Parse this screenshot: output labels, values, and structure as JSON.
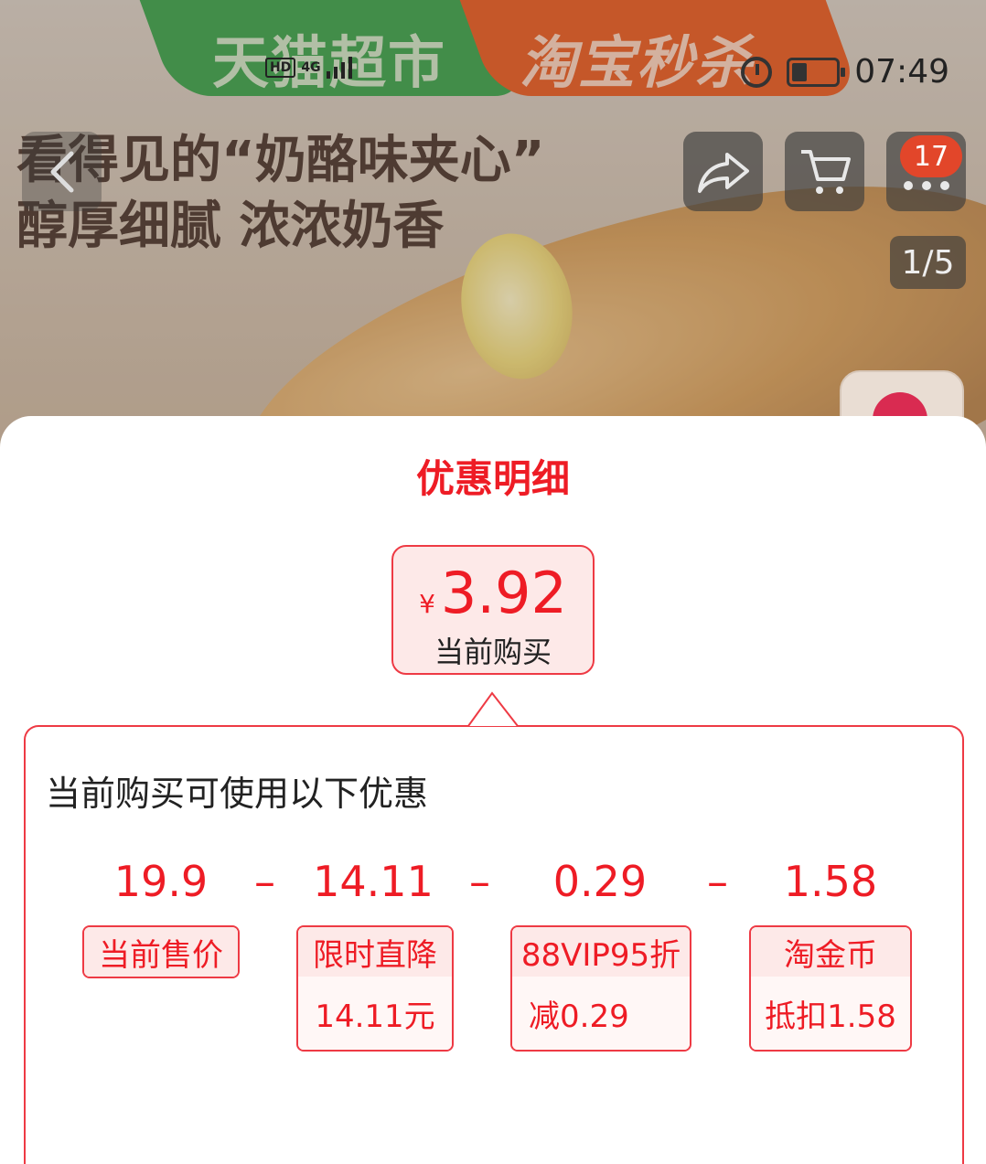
{
  "status_bar": {
    "time": "07:49",
    "network": "4G",
    "hd": "HD"
  },
  "banner": {
    "left_text": "天猫超市",
    "right_text": "淘宝秒杀"
  },
  "product_image": {
    "headline_line1": "看得见的“奶酪味夹心”",
    "headline_line2": "醇厚细腻 浓浓奶香"
  },
  "top_controls": {
    "back_icon": "chevron-left-icon",
    "share_icon": "share-icon",
    "cart_icon": "cart-icon",
    "more_icon": "more-icon",
    "message_count": "17",
    "pager": "1/5"
  },
  "sheet": {
    "title": "优惠明细",
    "price": {
      "currency": "¥",
      "value": "3.92",
      "label": "当前购买"
    },
    "heading": "当前购买可使用以下优惠",
    "amounts": [
      "19.9",
      "14.11",
      "0.29",
      "1.58"
    ],
    "operator": "–",
    "tags": [
      {
        "title": "当前售价"
      },
      {
        "title": "限时直降",
        "detail": "14.11元"
      },
      {
        "title": "88VIP95折",
        "detail": "减0.29"
      },
      {
        "title": "淘金币",
        "detail": "抵扣1.58"
      }
    ]
  },
  "colors": {
    "accent": "#ee1c25",
    "accent_border": "#ee3a44",
    "tag_bg": "#fde9e8"
  }
}
